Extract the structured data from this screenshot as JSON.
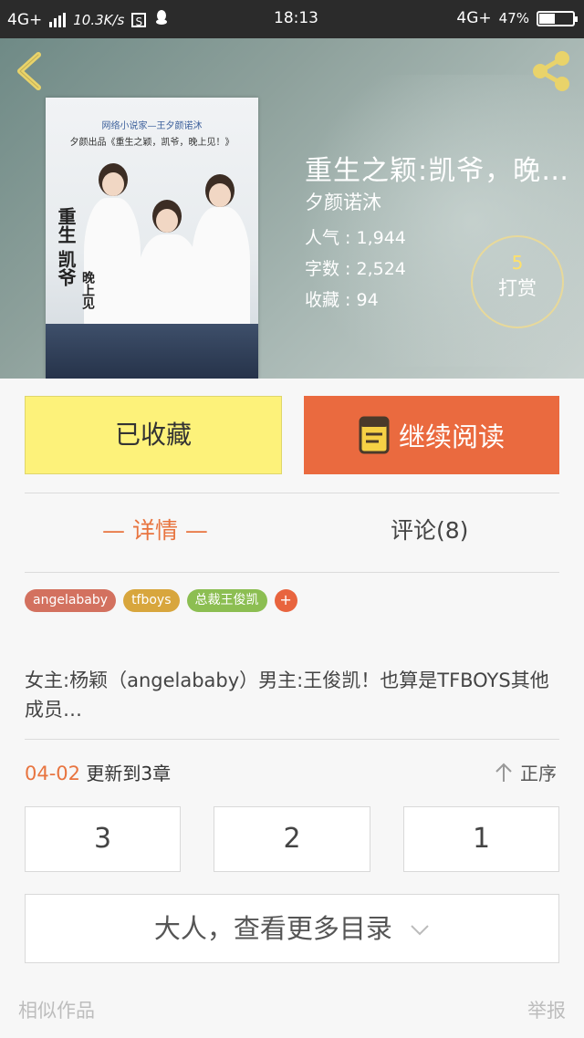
{
  "status_bar": {
    "network_left": "4G+",
    "speed": "10.3K/s",
    "s_icon": "S",
    "time": "18:13",
    "network_right": "4G+",
    "battery": "47%",
    "battery_level": 0.47
  },
  "book": {
    "title": "重生之颖:凯爷，晚…",
    "author": "夕颜诺沐",
    "popularity": "人气 : 1,944",
    "word_count": "字数 : 2,524",
    "favorites": "收藏 : 94",
    "reward_count": "5",
    "reward_label": "打赏"
  },
  "cover": {
    "line1": "网络小说家—王夕颜诺沐",
    "line2": "夕颜出品《重生之颖，凯爷，晚上见！》",
    "vertical_text": "重生 凯爷",
    "vertical_text2": "晚上见"
  },
  "actions": {
    "favorite_label": "已收藏",
    "read_label": "继续阅读"
  },
  "tabs": {
    "detail": "— 详情 —",
    "comments": "评论(8)"
  },
  "tags": [
    {
      "label": "angelababy",
      "color": "#d3715f"
    },
    {
      "label": "tfboys",
      "color": "#d8a63d"
    },
    {
      "label": "总裁王俊凯",
      "color": "#8cbe52"
    }
  ],
  "tag_plus": "+",
  "intro": "女主:杨颖（angelababy）男主:王俊凯！也算是TFBOYS其他成员…",
  "update": {
    "date": "04-02",
    "text": "更新到3章",
    "order_label": "正序"
  },
  "chapters": [
    "3",
    "2",
    "1"
  ],
  "more_catalog": "大人，查看更多目录",
  "footer": {
    "similar": "相似作品",
    "report": "举报"
  },
  "colors": {
    "accent_orange": "#ea6a3f",
    "favorite_yellow": "#fdf27a",
    "tab_active": "#e8743f"
  }
}
